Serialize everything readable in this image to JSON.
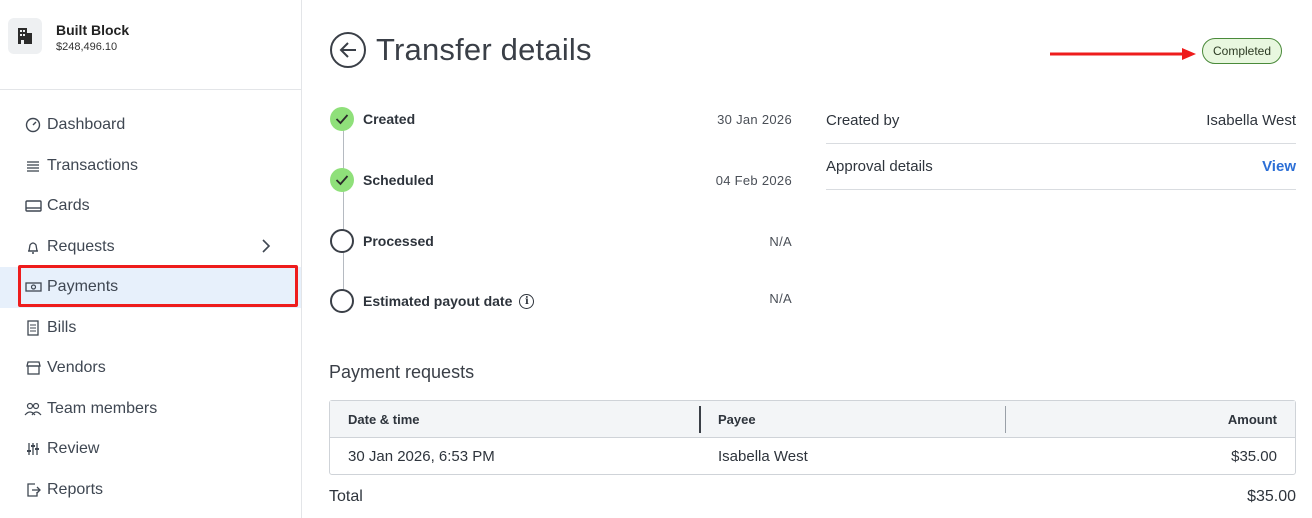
{
  "org": {
    "name": "Built Block",
    "balance": "$248,496.10"
  },
  "nav": {
    "items": [
      {
        "label": "Dashboard",
        "icon": "gauge-icon"
      },
      {
        "label": "Transactions",
        "icon": "list-icon"
      },
      {
        "label": "Cards",
        "icon": "card-icon"
      },
      {
        "label": "Requests",
        "icon": "bell-icon"
      },
      {
        "label": "Payments",
        "icon": "money-icon"
      },
      {
        "label": "Bills",
        "icon": "receipt-icon"
      },
      {
        "label": "Vendors",
        "icon": "store-icon"
      },
      {
        "label": "Team members",
        "icon": "people-icon"
      },
      {
        "label": "Review",
        "icon": "sliders-icon"
      },
      {
        "label": "Reports",
        "icon": "export-icon"
      }
    ],
    "active": "Payments"
  },
  "page": {
    "title": "Transfer details",
    "status": "Completed"
  },
  "timeline": [
    {
      "label": "Created",
      "date": "30 Jan 2026",
      "state": "done"
    },
    {
      "label": "Scheduled",
      "date": "04 Feb 2026",
      "state": "done"
    },
    {
      "label": "Processed",
      "date": "N/A",
      "state": "pending"
    },
    {
      "label": "Estimated payout date",
      "date": "N/A",
      "state": "pending"
    }
  ],
  "details": {
    "created_by_label": "Created by",
    "created_by_value": "Isabella West",
    "approval_label": "Approval details",
    "approval_link": "View"
  },
  "payment_requests": {
    "title": "Payment requests",
    "columns": {
      "date": "Date & time",
      "payee": "Payee",
      "amount": "Amount"
    },
    "rows": [
      {
        "date": "30 Jan 2026, 6:53 PM",
        "payee": "Isabella West",
        "amount": "$35.00"
      }
    ],
    "total_label": "Total",
    "total_value": "$35.00"
  },
  "colors": {
    "accent": "#2c6fd6",
    "status_bg": "#e8f7df",
    "done": "#8fe07a",
    "highlight": "#ee1c1c"
  }
}
